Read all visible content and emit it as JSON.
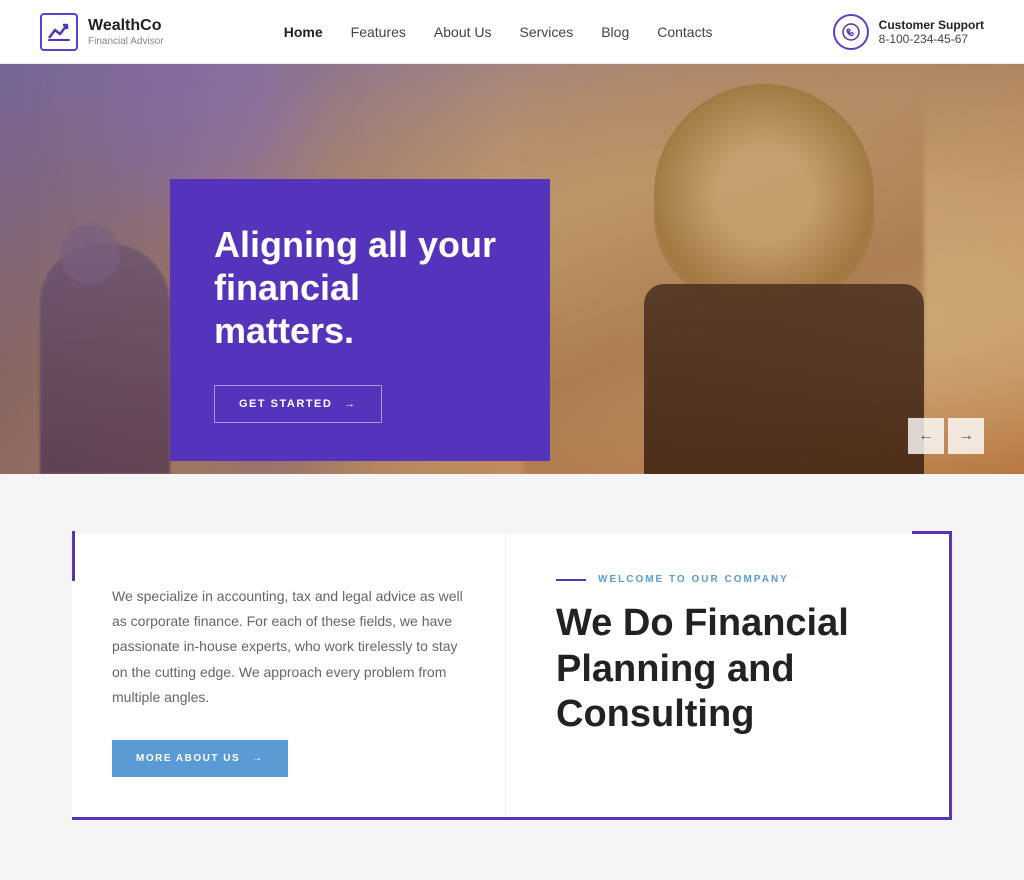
{
  "header": {
    "logo": {
      "name": "WealthCo",
      "tagline": "Financial Advisor"
    },
    "nav": {
      "items": [
        {
          "label": "Home",
          "active": true
        },
        {
          "label": "Features",
          "active": false
        },
        {
          "label": "About Us",
          "active": false
        },
        {
          "label": "Services",
          "active": false
        },
        {
          "label": "Blog",
          "active": false
        },
        {
          "label": "Contacts",
          "active": false
        }
      ]
    },
    "support": {
      "label": "Customer Support",
      "phone": "8-100-234-45-67"
    }
  },
  "hero": {
    "title": "Aligning all your financial matters.",
    "cta_label": "GET STARTED",
    "nav_prev": "←",
    "nav_next": "→"
  },
  "section": {
    "left": {
      "description": "We specialize in accounting, tax and legal advice as well as corporate finance. For each of these fields, we have passionate in-house experts, who work tirelessly to stay on the cutting edge. We approach every problem from multiple angles.",
      "cta_label": "MORE ABOUT US"
    },
    "right": {
      "welcome_label": "WELCOME TO OUR COMPANY",
      "title": "We Do Financial Planning and Consulting"
    }
  }
}
